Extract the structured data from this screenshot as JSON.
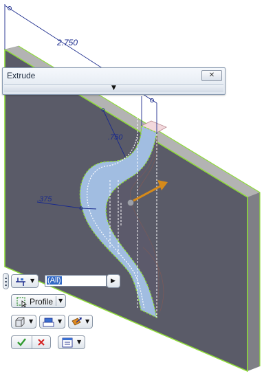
{
  "dialog": {
    "title": "Extrude",
    "close_glyph": "✕",
    "expand_glyph": "▼"
  },
  "dimensions": {
    "width": "2.750",
    "upper_radius": ".750",
    "lower_radius": ".375"
  },
  "minitoolbar": {
    "profile_field_value": "(All)",
    "profile_button_label": "Profile",
    "dropdown_glyph": "▼",
    "icons": [
      "output-type-icon",
      "solid-icon",
      "boolean-join-icon",
      "direction-icon",
      "ok-icon",
      "cancel-icon",
      "options-menu-icon"
    ]
  },
  "colors": {
    "plate_face": "#5a5b68",
    "plate_top": "#b3b3b3",
    "plate_side": "#7f7f86",
    "highlight_edge": "#8fdc3a",
    "preview_fill": "#a9c8ee",
    "dimension": "#1a2a8c",
    "arrow": "#d58a1a"
  }
}
